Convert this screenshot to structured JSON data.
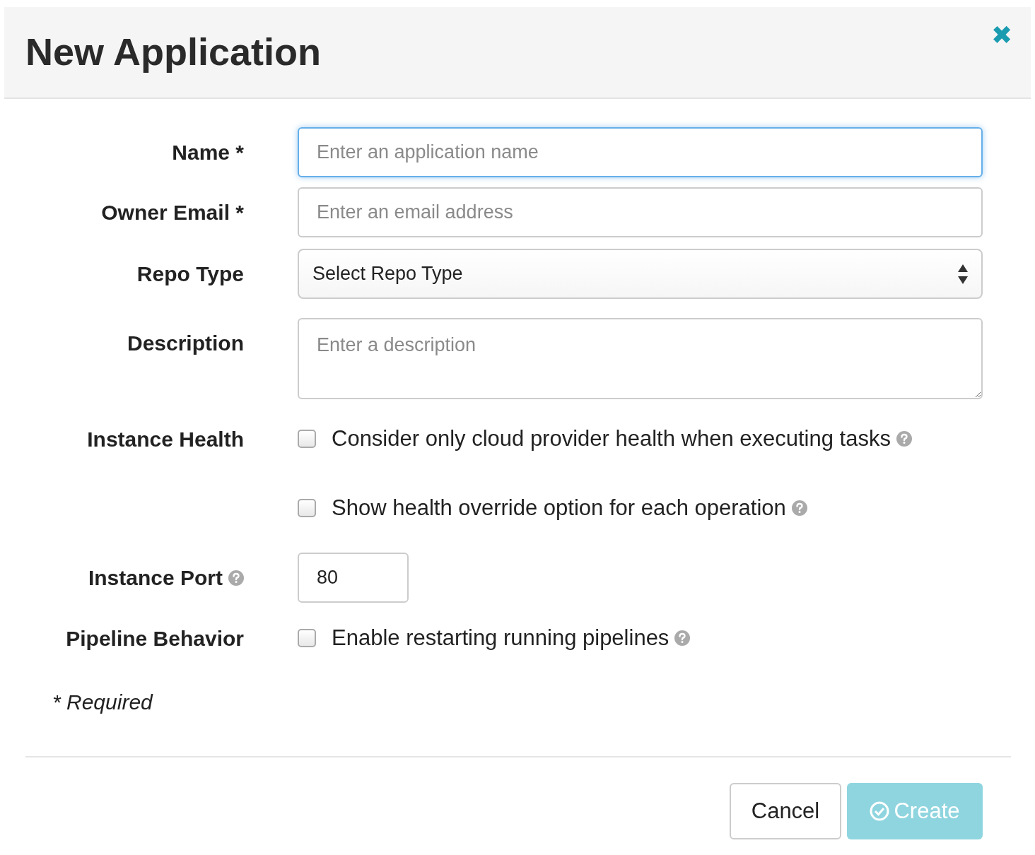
{
  "dialog": {
    "title": "New Application",
    "close": "✖"
  },
  "fields": [
    {
      "label": "Name *",
      "kind": "text",
      "placeholder": "Enter an application name",
      "focused": true
    },
    {
      "label": "Owner Email *",
      "kind": "text",
      "placeholder": "Enter an email address",
      "focused": false
    },
    {
      "label": "Repo Type",
      "kind": "select",
      "value": "Select Repo Type"
    },
    {
      "label": "Description",
      "kind": "textarea",
      "placeholder": "Enter a description"
    },
    {
      "label": "Instance Health",
      "kind": "checkboxes",
      "options": [
        {
          "label": "Consider only cloud provider health when executing tasks",
          "checked": false
        },
        {
          "label": "Show health override option for each operation",
          "checked": false
        }
      ]
    },
    {
      "label": "Instance Port",
      "kind": "number",
      "value": "80",
      "label_help": true
    },
    {
      "label": "Pipeline Behavior",
      "kind": "checkboxes",
      "options": [
        {
          "label": "Enable restarting running pipelines",
          "checked": false
        }
      ]
    }
  ],
  "required_note": "* Required",
  "buttons": [
    {
      "label": "Cancel",
      "kind": "secondary",
      "disabled": false
    },
    {
      "label": "Create",
      "kind": "primary",
      "disabled": true
    }
  ]
}
